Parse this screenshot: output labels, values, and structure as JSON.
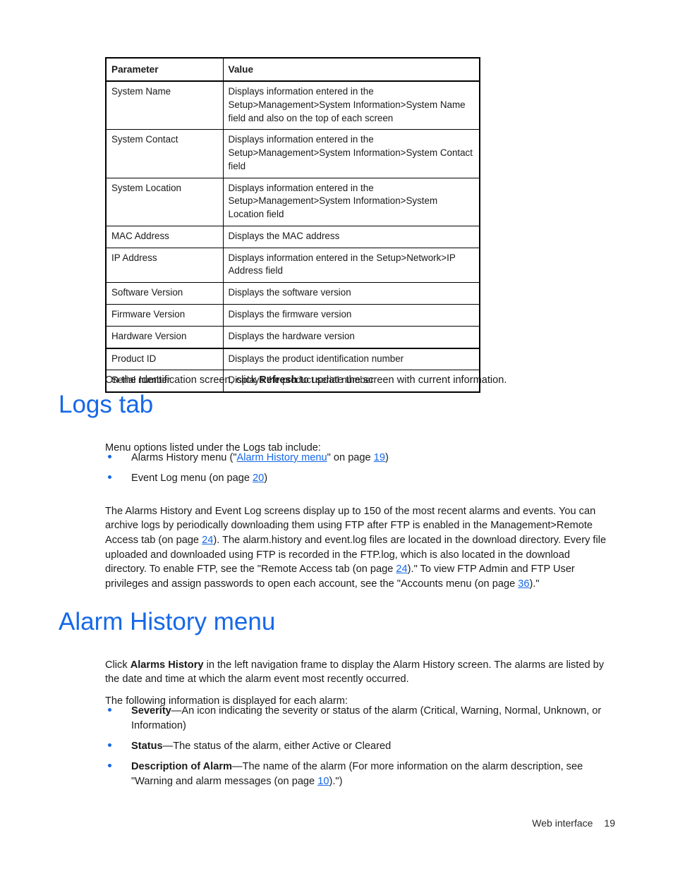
{
  "table": {
    "headers": [
      "Parameter",
      "Value"
    ],
    "rows": [
      {
        "parameter": "System Name",
        "value": "Displays information entered in the Setup>Management>System Information>System Name field and also on the top of each screen"
      },
      {
        "parameter": "System Contact",
        "value": "Displays information entered in the Setup>Management>System Information>System Contact field"
      },
      {
        "parameter": "System Location",
        "value": "Displays information entered in the Setup>Management>System Information>System Location field"
      },
      {
        "parameter": "MAC Address",
        "value": "Displays the MAC address"
      },
      {
        "parameter": "IP Address",
        "value": "Displays information entered in the Setup>Network>IP Address field"
      },
      {
        "parameter": "Software Version",
        "value": "Displays the software version"
      },
      {
        "parameter": "Firmware Version",
        "value": "Displays the firmware version"
      },
      {
        "parameter": "Hardware Version",
        "value": "Displays the hardware version"
      },
      {
        "parameter": "Product ID",
        "value": "Displays the product identification number"
      },
      {
        "parameter": "Serial number",
        "value": "Displays the product serial number"
      }
    ]
  },
  "identification_note": {
    "before": "On the Identification screen, click ",
    "bold": "Refresh",
    "after": " to update the screen with current information."
  },
  "logs_tab": {
    "heading": "Logs tab",
    "intro": "Menu options listed under the Logs tab include:",
    "bullets": [
      {
        "before": "Alarms History menu (\"",
        "link": "Alarm History menu",
        "middle": "\" on page ",
        "page": "19",
        "after": ")"
      },
      {
        "before": "Event Log menu (on page ",
        "page": "20",
        "after": ")"
      }
    ],
    "paragraph": {
      "p1": "The Alarms History and Event Log screens display up to 150 of the most recent alarms and events. You can archive logs by periodically downloading them using FTP after FTP is enabled in the Management>Remote Access tab (on page ",
      "page1": "24",
      "p2": "). The alarm.history and event.log files are located in the download directory. Every file uploaded and downloaded using FTP is recorded in the FTP.log, which is also located in the download directory. To enable FTP, see the \"Remote Access tab (on page ",
      "page2": "24",
      "p3": ").\" To view FTP Admin and FTP User privileges and assign passwords to open each account, see the \"Accounts menu (on page ",
      "page3": "36",
      "p4": ").\""
    }
  },
  "alarm_history": {
    "heading": "Alarm History menu",
    "intro": {
      "before": "Click ",
      "bold": "Alarms History",
      "after": " in the left navigation frame to display the Alarm History screen. The alarms are listed by the date and time at which the alarm event most recently occurred."
    },
    "subintro": "The following information is displayed for each alarm:",
    "bullets": [
      {
        "bold": "Severity",
        "text": "—An icon indicating the severity or status of the alarm (Critical, Warning, Normal, Unknown, or Information)"
      },
      {
        "bold": "Status",
        "text": "—The status of the alarm, either Active or Cleared"
      },
      {
        "bold": "Description of Alarm",
        "text_before": "—The name of the alarm (For more information on the alarm description, see \"Warning and alarm messages (on page ",
        "page": "10",
        "text_after": ").\")"
      }
    ]
  },
  "footer": {
    "label": "Web interface",
    "page_number": "19"
  },
  "colors": {
    "accent_blue": "#1668e8",
    "text": "#1a1a1a"
  }
}
